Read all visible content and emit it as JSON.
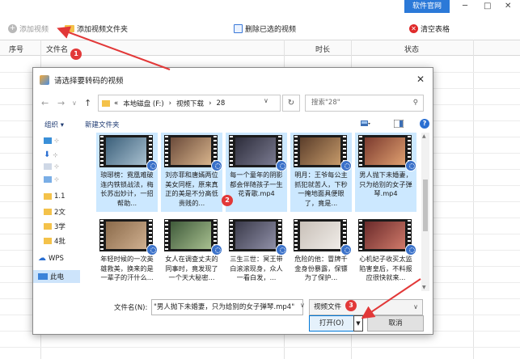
{
  "app": {
    "official_badge": "软件官网",
    "window_buttons": [
      "─",
      "□",
      "✕"
    ]
  },
  "toolbar": {
    "add_video": "添加视频",
    "add_folder": "添加视频文件夹",
    "delete_converted": "删除已选的视频",
    "clear_table": "清空表格"
  },
  "table": {
    "columns": [
      "序号",
      "文件名",
      "时长",
      "状态"
    ]
  },
  "dialog": {
    "title": "请选择要转码的视频",
    "close": "✕",
    "address": {
      "prefix": "«",
      "parts": [
        "本地磁盘 (F:)",
        "›",
        "视频下载",
        "›",
        "28"
      ]
    },
    "search_placeholder": "搜索\"28\"",
    "organize": "组织 ▾",
    "new_folder": "新建文件夹",
    "help": "?",
    "nav_items": [
      "1.1",
      "2文",
      "3学",
      "4批",
      "WPS",
      "此电"
    ],
    "files": [
      {
        "caption": "琅琊榜：霓凰难破连内铁锁战法，梅长苏出妙计，一招帮助...",
        "selected": true
      },
      {
        "caption": "刘亦菲和唐嫣两位美女同框，原来真正的美是不分高低贵贱的...",
        "selected": true
      },
      {
        "caption": "每一个童年的阴影都会伴随孩子一生花青歌.mp4",
        "selected": true
      },
      {
        "caption": "明月：王爷每公主抓犯就苦人，下秒一掩地面具便眼了，竟是...",
        "selected": true
      },
      {
        "caption": "男人抛下未婚妻，只为给别的女子弹琴.mp4",
        "selected": true
      },
      {
        "caption": "年轻时候的一次英雄救美，换来的是一辈子的汗什么...",
        "selected": false
      },
      {
        "caption": "女人在调查丈夫的同事时，竟发现了一个天大秘密...",
        "selected": false
      },
      {
        "caption": "三生三世：冥王带白滚滚现身，众人一看白发，...",
        "selected": false
      },
      {
        "caption": "危险的他：冒牌千金身份暴露，保镖为了保护...",
        "selected": false
      },
      {
        "caption": "心机妃子收买太监陷害皇后，不料报应很快就来...",
        "selected": false
      }
    ],
    "filename_label": "文件名(N):",
    "filename_value": "\"男人抛下未婚妻，只为给别的女子弹琴.mp4\"",
    "filetype": "视频文件",
    "open_button": "打开(O)",
    "cancel_button": "取消"
  },
  "annotations": [
    "1",
    "2",
    "3"
  ],
  "colors": {
    "accent": "#2b79d8",
    "annotation_red": "#e23838",
    "selection": "#cce8ff"
  }
}
